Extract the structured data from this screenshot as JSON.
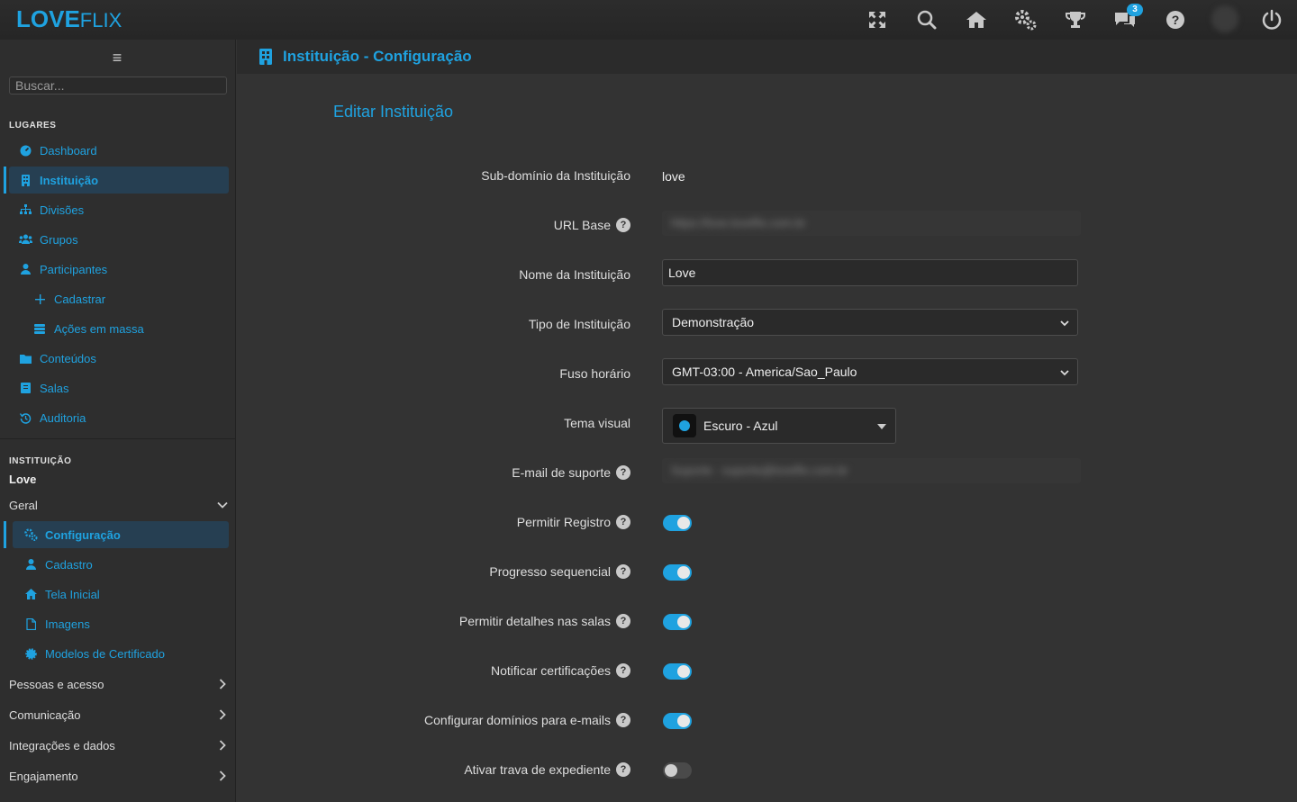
{
  "colors": {
    "accent": "#1fa2e0",
    "background": "#333333",
    "sidebar": "#2e2e2e",
    "active_bg": "#263f52"
  },
  "logo": {
    "part1": "LOVE",
    "part2": "FLIX"
  },
  "topbar": {
    "icons": [
      "fullscreen-icon",
      "search-icon",
      "home-icon",
      "settings-icon",
      "trophy-icon",
      "chat-icon",
      "help-icon",
      "avatar",
      "power-icon"
    ],
    "chat_badge": "3"
  },
  "sidebar": {
    "search_placeholder": "Buscar...",
    "places_title": "LUGARES",
    "places": [
      {
        "label": "Dashboard",
        "icon": "dashboard-icon"
      },
      {
        "label": "Instituição",
        "icon": "building-icon",
        "active": true
      },
      {
        "label": "Divisões",
        "icon": "sitemap-icon"
      },
      {
        "label": "Grupos",
        "icon": "users-icon"
      },
      {
        "label": "Participantes",
        "icon": "user-icon"
      },
      {
        "label": "Cadastrar",
        "icon": "plus-icon",
        "sub": true
      },
      {
        "label": "Ações em massa",
        "icon": "layers-icon",
        "sub": true
      },
      {
        "label": "Conteúdos",
        "icon": "folder-icon"
      },
      {
        "label": "Salas",
        "icon": "book-icon"
      },
      {
        "label": "Auditoria",
        "icon": "history-icon"
      }
    ],
    "institution_title": "INSTITUIÇÃO",
    "institution_name": "Love",
    "general_group": "Geral",
    "general_items": [
      {
        "label": "Configuração",
        "icon": "cogs-icon",
        "active": true
      },
      {
        "label": "Cadastro",
        "icon": "user-icon"
      },
      {
        "label": "Tela Inicial",
        "icon": "home-icon"
      },
      {
        "label": "Imagens",
        "icon": "file-icon"
      },
      {
        "label": "Modelos de Certificado",
        "icon": "certificate-icon"
      }
    ],
    "groups": [
      "Pessoas e acesso",
      "Comunicação",
      "Integrações e dados",
      "Engajamento"
    ]
  },
  "header": {
    "title": "Instituição - Configuração"
  },
  "form": {
    "subtitle": "Editar Instituição",
    "subdomain_label": "Sub-domínio da Instituição",
    "subdomain_value": "love",
    "url_label": "URL Base",
    "url_value": "https://love.loveflix.com.br",
    "name_label": "Nome da Instituição",
    "name_value": "Love",
    "type_label": "Tipo de Instituição",
    "type_value": "Demonstração",
    "tz_label": "Fuso horário",
    "tz_value": "GMT-03:00 - America/Sao_Paulo",
    "theme_label": "Tema visual",
    "theme_value": "Escuro - Azul",
    "email_label": "E-mail de suporte",
    "email_value": "Suporte - suporte@loveflix.com.br",
    "toggles": [
      {
        "label": "Permitir Registro",
        "on": true
      },
      {
        "label": "Progresso sequencial",
        "on": true
      },
      {
        "label": "Permitir detalhes nas salas",
        "on": true
      },
      {
        "label": "Notificar certificações",
        "on": true
      },
      {
        "label": "Configurar domínios para e-mails",
        "on": true
      },
      {
        "label": "Ativar trava de expediente",
        "on": false
      }
    ]
  }
}
